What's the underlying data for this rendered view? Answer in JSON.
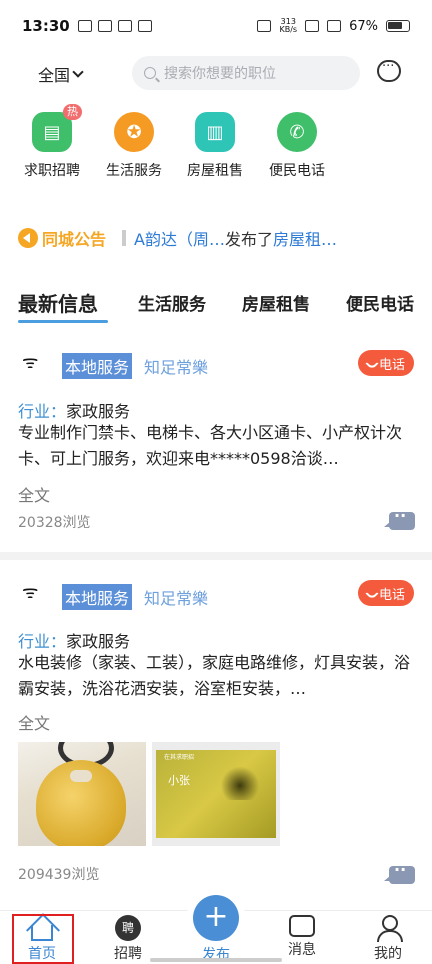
{
  "status_bar": {
    "time": "13:30",
    "net_speed_value": "313",
    "net_speed_unit": "KB/s",
    "battery": "67%"
  },
  "header": {
    "city": "全国",
    "search_placeholder": "搜索你想要的职位"
  },
  "quick_links": [
    {
      "label": "求职招聘",
      "icon": "briefcase-icon",
      "color": "#3fbf6a",
      "badge": "热"
    },
    {
      "label": "生活服务",
      "icon": "medal-icon",
      "color": "#f59a23"
    },
    {
      "label": "房屋租售",
      "icon": "building-icon",
      "color": "#2ec4b6"
    },
    {
      "label": "便民电话",
      "icon": "phone-icon",
      "color": "#3fbf6a"
    }
  ],
  "notice": {
    "title": "同城公告",
    "name": "A韵达（周…",
    "action": "发布了",
    "category": "房屋租…"
  },
  "tabs": [
    "最新信息",
    "生活服务",
    "房屋租售",
    "便民电话"
  ],
  "posts": [
    {
      "tag": "本地服务",
      "name": "知足常樂",
      "call": "电话",
      "industry_label": "行业：",
      "industry": "家政服务",
      "content": "专业制作门禁卡、电梯卡、各大小区通卡、小产权计次卡、可上门服务，欢迎来电*****0598洽谈…",
      "full": "全文",
      "views": "20328浏览"
    },
    {
      "tag": "本地服务",
      "name": "知足常樂",
      "call": "电话",
      "industry_label": "行业：",
      "industry": "家政服务",
      "content": "水电装修（家装、工装），家庭电路维修，灯具安装，浴霸安装，洗浴花洒安装，浴室柜安装，…",
      "full": "全文",
      "views": "209439浏览",
      "card_title": "小张",
      "card_header": "在其求职招"
    }
  ],
  "bottom_nav": {
    "home": "首页",
    "recruit": "招聘",
    "recruit_glyph": "聘",
    "publish": "发布",
    "messages": "消息",
    "me": "我的"
  }
}
